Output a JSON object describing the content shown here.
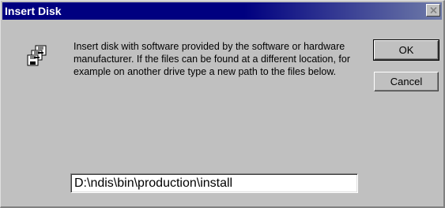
{
  "window": {
    "title": "Insert Disk"
  },
  "icons": {
    "title_close": "close-icon",
    "disk": "disk-icon"
  },
  "message": {
    "text": "Insert disk with software provided by the software or hardware manufacturer.  If the files can be found at a different location, for example on another drive type a new path to the files below."
  },
  "buttons": {
    "ok_label": "OK",
    "cancel_label": "Cancel"
  },
  "path_input": {
    "value": "D:\\ndis\\bin\\production\\install"
  },
  "colors": {
    "titlebar": "#000080",
    "titlebar_fade": "#6f7ba8",
    "dialog_face": "#c0c0c0",
    "field_background": "#ffffff"
  }
}
